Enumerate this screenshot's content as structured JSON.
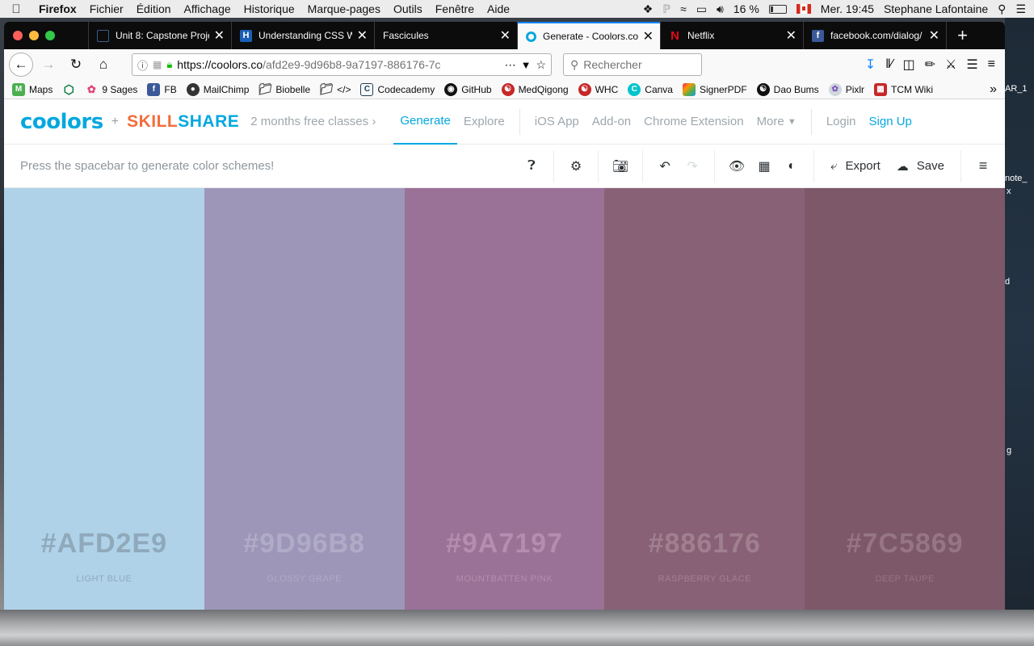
{
  "menubar": {
    "app": "Firefox",
    "items": [
      "Fichier",
      "Édition",
      "Affichage",
      "Historique",
      "Marque-pages",
      "Outils",
      "Fenêtre",
      "Aide"
    ],
    "battery": "16 %",
    "clock": "Mer. 19:45",
    "user": "Stephane Lafontaine"
  },
  "desktop": {
    "labels": [
      "AR_1",
      "note_",
      "x",
      "d",
      "g"
    ]
  },
  "tabs": [
    {
      "label": "Unit 8: Capstone Proje",
      "icon": "page-icon",
      "active": false
    },
    {
      "label": "Understanding CSS W",
      "icon": "h-icon",
      "active": false
    },
    {
      "label": "Fascicules",
      "icon": "",
      "active": false
    },
    {
      "label": "Generate - Coolors.co",
      "icon": "coolors-icon",
      "active": true
    },
    {
      "label": "Netflix",
      "icon": "netflix-icon",
      "active": false
    },
    {
      "label": "facebook.com/dialog/",
      "icon": "facebook-icon",
      "active": false
    }
  ],
  "navbar": {
    "url_host": "https://coolors.co",
    "url_path": "/afd2e9-9d96b8-9a7197-886176-7c",
    "search_placeholder": "Rechercher"
  },
  "bookmarks": [
    "Maps",
    "",
    "9 Sages",
    "FB",
    "MailChimp",
    "Biobelle",
    "</>",
    "Codecademy",
    "GitHub",
    "MedQigong",
    "WHC",
    "Canva",
    "SignerPDF",
    "Dao Bums",
    "Pixlr",
    "TCM Wiki"
  ],
  "site": {
    "logo": "coolors",
    "plus": "+",
    "partner_a": "SKILL",
    "partner_b": "SHARE",
    "promo": "2 months free classes",
    "promo_arrow": "›",
    "nav": [
      "Generate",
      "Explore",
      "iOS App",
      "Add-on",
      "Chrome Extension",
      "More",
      "Login",
      "Sign Up"
    ]
  },
  "toolbar": {
    "hint": "Press the spacebar to generate color schemes!",
    "export": "Export",
    "save": "Save"
  },
  "palette": [
    {
      "hex": "#AFD2E9",
      "name": "LIGHT BLUE",
      "color": "#afd2e9",
      "hexColor": "#8fa9bb",
      "nameColor": "#8fa9bb"
    },
    {
      "hex": "#9D96B8",
      "name": "GLOSSY GRAPE",
      "color": "#9d96b8",
      "hexColor": "#b0abc6",
      "nameColor": "#b0abc6"
    },
    {
      "hex": "#9A7197",
      "name": "MOUNTBATTEN PINK",
      "color": "#9a7197",
      "hexColor": "#b38eb0",
      "nameColor": "#b38eb0"
    },
    {
      "hex": "#886176",
      "name": "RASPBERRY GLACE",
      "color": "#886176",
      "hexColor": "#a0808f",
      "nameColor": "#a0808f"
    },
    {
      "hex": "#7C5869",
      "name": "DEEP TAUPE",
      "color": "#7c5869",
      "hexColor": "#967584",
      "nameColor": "#967584"
    }
  ]
}
